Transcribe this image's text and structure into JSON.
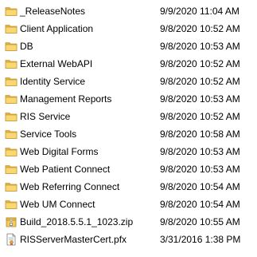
{
  "files": [
    {
      "name": "_ReleaseNotes",
      "modified": "9/9/2020 11:04 AM",
      "icon": "folder-icon"
    },
    {
      "name": "Client Application",
      "modified": "9/8/2020 10:52 AM",
      "icon": "folder-icon"
    },
    {
      "name": "DB",
      "modified": "9/8/2020 10:53 AM",
      "icon": "folder-icon"
    },
    {
      "name": "External WebAPI",
      "modified": "9/8/2020 10:52 AM",
      "icon": "folder-icon"
    },
    {
      "name": "Identity Service",
      "modified": "9/8/2020 10:52 AM",
      "icon": "folder-icon"
    },
    {
      "name": "Management Reports",
      "modified": "9/8/2020 10:53 AM",
      "icon": "folder-icon"
    },
    {
      "name": "RIS Service",
      "modified": "9/8/2020 10:52 AM",
      "icon": "folder-icon"
    },
    {
      "name": "Service Tools",
      "modified": "9/8/2020 10:58 AM",
      "icon": "folder-icon"
    },
    {
      "name": "Web Digital Forms",
      "modified": "9/8/2020 10:53 AM",
      "icon": "folder-icon"
    },
    {
      "name": "Web Patient Connect",
      "modified": "9/8/2020 10:53 AM",
      "icon": "folder-icon"
    },
    {
      "name": "Web Referring Connect",
      "modified": "9/8/2020 10:54 AM",
      "icon": "folder-icon"
    },
    {
      "name": "Web UM Connect",
      "modified": "9/8/2020 10:54 AM",
      "icon": "folder-icon"
    },
    {
      "name": "Build_2018.5.5.1_1023.zip",
      "modified": "9/8/2020 10:55 AM",
      "icon": "zip-archive-icon"
    },
    {
      "name": "RISServerMasterCert.pfx",
      "modified": "3/31/2016 1:38 PM",
      "icon": "certificate-file-icon"
    }
  ],
  "colors": {
    "folder_body": "#f8d775",
    "folder_back": "#e2b340",
    "folder_edge": "#c99a2e"
  }
}
